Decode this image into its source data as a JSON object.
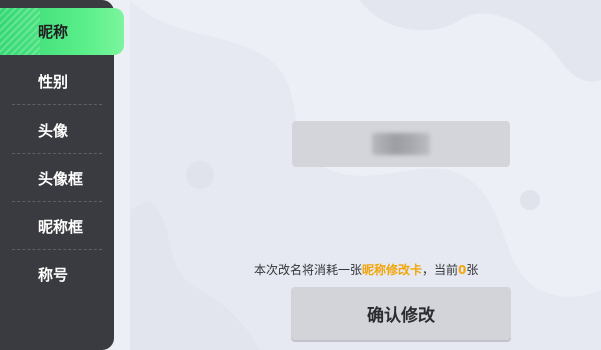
{
  "sidebar": {
    "items": [
      {
        "label": "昵称",
        "active": true
      },
      {
        "label": "性别",
        "active": false
      },
      {
        "label": "头像",
        "active": false
      },
      {
        "label": "头像框",
        "active": false
      },
      {
        "label": "昵称框",
        "active": false
      },
      {
        "label": "称号",
        "active": false
      }
    ]
  },
  "main": {
    "consume_prefix": "本次改名将消耗一张",
    "card_name": "昵称修改卡",
    "consume_mid": "，当前",
    "card_count": "0",
    "consume_suffix": "张",
    "confirm_label": "确认修改"
  },
  "colors": {
    "accent_green": "#4fe37f",
    "highlight_orange": "#f2a60c",
    "sidebar_bg": "#3a3b40"
  }
}
